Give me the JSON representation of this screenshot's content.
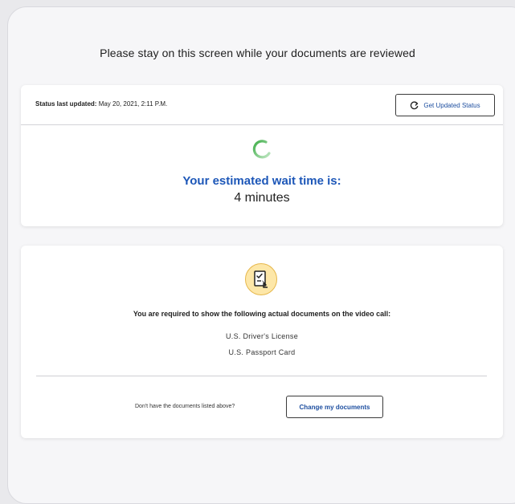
{
  "page": {
    "title": "Please stay on this screen while your documents are reviewed"
  },
  "status": {
    "label": "Status last updated:",
    "timestamp": "May 20, 2021, 2:11 P.M.",
    "refresh_button": "Get Updated Status",
    "wait_label": "Your estimated wait time is:",
    "wait_value": "4 minutes"
  },
  "documents": {
    "required_text": "You are required to show the following actual documents on the video call:",
    "items": [
      "U.S. Driver's License",
      "U.S. Passport Card"
    ],
    "footer_prompt": "Don't have the documents listed above?",
    "change_button": "Change my documents"
  },
  "icons": {
    "refresh": "refresh-icon",
    "spinner": "loading-spinner-icon",
    "document": "document-checklist-icon"
  },
  "colors": {
    "accent_blue": "#1d57b8",
    "spinner_green": "#3fae49",
    "icon_badge": "#fde7a8"
  }
}
